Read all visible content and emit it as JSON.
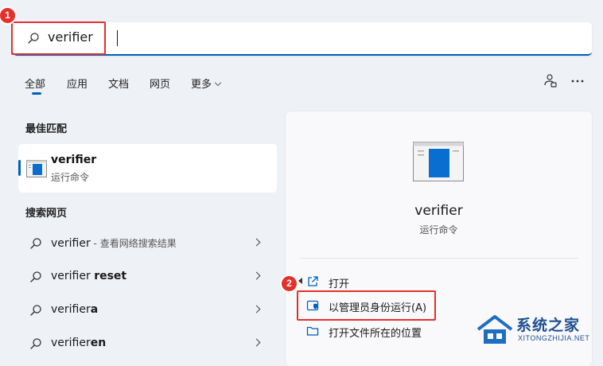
{
  "search": {
    "query": "verifier"
  },
  "annotations": {
    "step1": "1",
    "step2": "2"
  },
  "tabs": [
    {
      "label": "全部"
    },
    {
      "label": "应用"
    },
    {
      "label": "文档"
    },
    {
      "label": "网页"
    },
    {
      "label": "更多"
    }
  ],
  "best_match": {
    "section_title": "最佳匹配",
    "title": "verifier",
    "subtitle": "运行命令"
  },
  "web_search": {
    "section_title": "搜索网页",
    "items": [
      {
        "prefix": "verifier",
        "bold": "",
        "desc": " - 查看网络搜索结果"
      },
      {
        "prefix": "verifier ",
        "bold": "reset",
        "desc": ""
      },
      {
        "prefix": "verifier",
        "bold": "a",
        "desc": ""
      },
      {
        "prefix": "verifier",
        "bold": "en",
        "desc": ""
      }
    ]
  },
  "detail": {
    "title": "verifier",
    "subtitle": "运行命令",
    "actions": [
      {
        "label": "打开"
      },
      {
        "label": "以管理员身份运行(A)"
      },
      {
        "label": "打开文件所在的位置"
      }
    ]
  },
  "watermark": {
    "title": "系统之家",
    "subtitle": "XITONGZHIJIA.NET"
  },
  "colors": {
    "accent": "#005fb8",
    "highlight": "#e4312b",
    "background": "#eef1f6"
  }
}
